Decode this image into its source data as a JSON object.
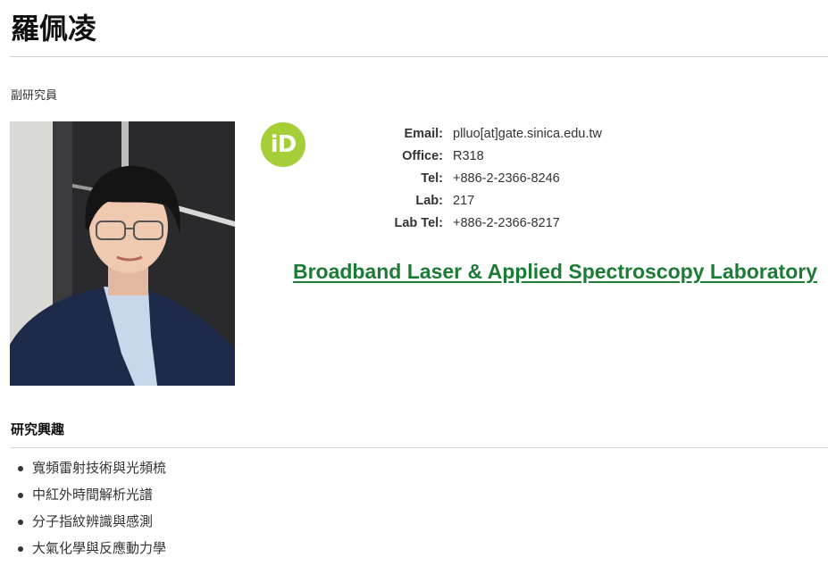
{
  "profile": {
    "name": "羅佩凌",
    "position": "副研究員",
    "orcid_label": "iD",
    "contact": [
      {
        "label": "Email:",
        "value": "plluo[at]gate.sinica.edu.tw"
      },
      {
        "label": "Office:",
        "value": "R318"
      },
      {
        "label": "Tel:",
        "value": "+886-2-2366-8246"
      },
      {
        "label": "Lab:",
        "value": "217"
      },
      {
        "label": "Lab Tel:",
        "value": "+886-2-2366-8217"
      }
    ],
    "lab_link": "Broadband Laser & Applied Spectroscopy Laboratory"
  },
  "interests": {
    "title": "研究興趣",
    "items": [
      "寬頻雷射技術與光頻梳",
      "中紅外時間解析光譜",
      "分子指紋辨識與感測",
      "大氣化學與反應動力學"
    ]
  },
  "colors": {
    "link": "#1c7c35",
    "orcid": "#a6ce39"
  }
}
